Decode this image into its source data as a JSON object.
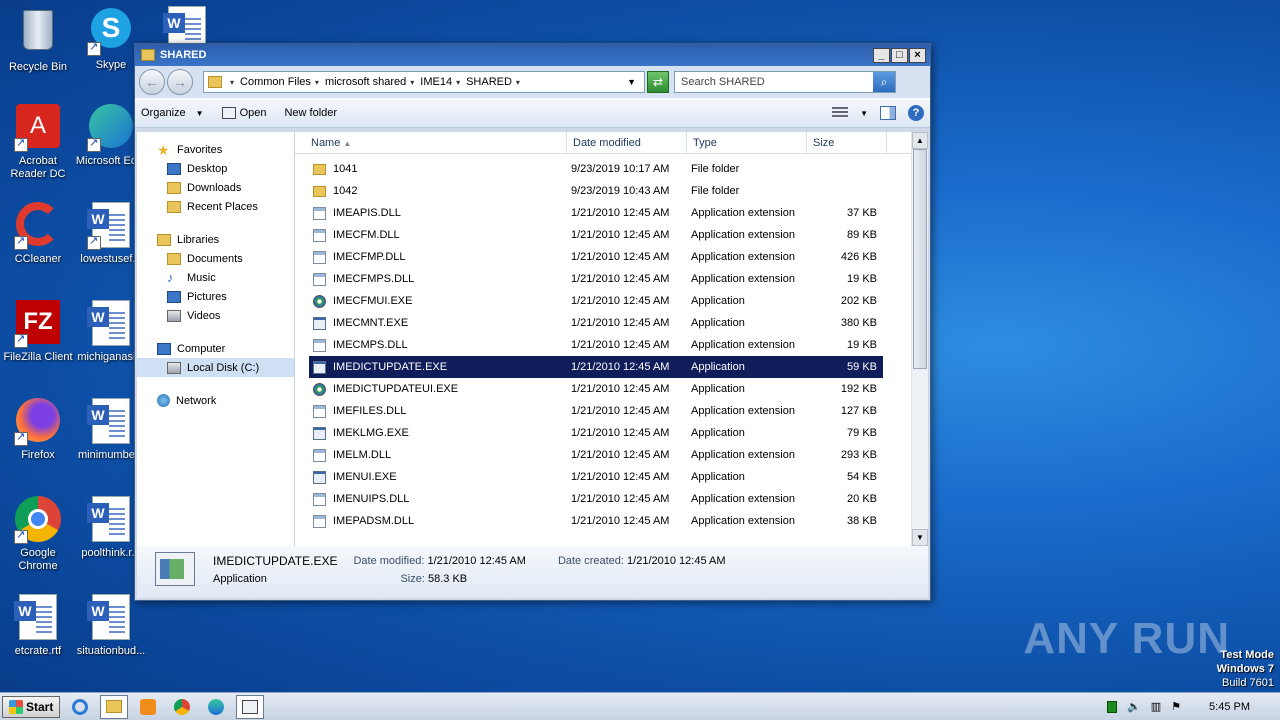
{
  "desktop": {
    "icons": [
      {
        "label": "Recycle Bin"
      },
      {
        "label": "Skype"
      },
      {
        "label": "Acrobat Reader DC"
      },
      {
        "label": "Microsoft Ed..."
      },
      {
        "label": "CCleaner"
      },
      {
        "label": "lowestusef..."
      },
      {
        "label": "FileZilla Client"
      },
      {
        "label": "michiganasi..."
      },
      {
        "label": "Firefox"
      },
      {
        "label": "minimumbe..."
      },
      {
        "label": "Google Chrome"
      },
      {
        "label": "poolthink.r..."
      },
      {
        "label": "etcrate.rtf"
      },
      {
        "label": "situationbud..."
      }
    ],
    "watermark": "ANY RUN",
    "test_mode": {
      "line1": "Test Mode",
      "line2": "Windows 7",
      "line3": "Build 7601"
    }
  },
  "window": {
    "title": "SHARED",
    "controls": {
      "minimize": "_",
      "maximize": "□",
      "close": "×"
    },
    "address": {
      "crumbs": [
        "Common Files",
        "microsoft shared",
        "IME14",
        "SHARED"
      ]
    },
    "search": {
      "placeholder": "Search SHARED"
    },
    "toolbar": {
      "organize": "Organize",
      "open": "Open",
      "new_folder": "New folder"
    },
    "nav": {
      "favorites": "Favorites",
      "desktop": "Desktop",
      "downloads": "Downloads",
      "recent": "Recent Places",
      "libraries": "Libraries",
      "documents": "Documents",
      "music": "Music",
      "pictures": "Pictures",
      "videos": "Videos",
      "computer": "Computer",
      "local_disk": "Local Disk (C:)",
      "network": "Network"
    },
    "columns": {
      "name": "Name",
      "date": "Date modified",
      "type": "Type",
      "size": "Size"
    },
    "files": [
      {
        "name": "1041",
        "date": "9/23/2019 10:17 AM",
        "type": "File folder",
        "size": "",
        "icon": "folder"
      },
      {
        "name": "1042",
        "date": "9/23/2019 10:43 AM",
        "type": "File folder",
        "size": "",
        "icon": "folder"
      },
      {
        "name": "IMEAPIS.DLL",
        "date": "1/21/2010 12:45 AM",
        "type": "Application extension",
        "size": "37 KB",
        "icon": "dll"
      },
      {
        "name": "IMECFM.DLL",
        "date": "1/21/2010 12:45 AM",
        "type": "Application extension",
        "size": "89 KB",
        "icon": "dll"
      },
      {
        "name": "IMECFMP.DLL",
        "date": "1/21/2010 12:45 AM",
        "type": "Application extension",
        "size": "426 KB",
        "icon": "dll"
      },
      {
        "name": "IMECFMPS.DLL",
        "date": "1/21/2010 12:45 AM",
        "type": "Application extension",
        "size": "19 KB",
        "icon": "dll"
      },
      {
        "name": "IMECFMUI.EXE",
        "date": "1/21/2010 12:45 AM",
        "type": "Application",
        "size": "202 KB",
        "icon": "exe-green"
      },
      {
        "name": "IMECMNT.EXE",
        "date": "1/21/2010 12:45 AM",
        "type": "Application",
        "size": "380 KB",
        "icon": "exe"
      },
      {
        "name": "IMECMPS.DLL",
        "date": "1/21/2010 12:45 AM",
        "type": "Application extension",
        "size": "19 KB",
        "icon": "dll"
      },
      {
        "name": "IMEDICTUPDATE.EXE",
        "date": "1/21/2010 12:45 AM",
        "type": "Application",
        "size": "59 KB",
        "icon": "exe"
      },
      {
        "name": "IMEDICTUPDATEUI.EXE",
        "date": "1/21/2010 12:45 AM",
        "type": "Application",
        "size": "192 KB",
        "icon": "exe-green"
      },
      {
        "name": "IMEFILES.DLL",
        "date": "1/21/2010 12:45 AM",
        "type": "Application extension",
        "size": "127 KB",
        "icon": "dll"
      },
      {
        "name": "IMEKLMG.EXE",
        "date": "1/21/2010 12:45 AM",
        "type": "Application",
        "size": "79 KB",
        "icon": "exe"
      },
      {
        "name": "IMELM.DLL",
        "date": "1/21/2010 12:45 AM",
        "type": "Application extension",
        "size": "293 KB",
        "icon": "dll"
      },
      {
        "name": "IMENUI.EXE",
        "date": "1/21/2010 12:45 AM",
        "type": "Application",
        "size": "54 KB",
        "icon": "exe"
      },
      {
        "name": "IMENUIPS.DLL",
        "date": "1/21/2010 12:45 AM",
        "type": "Application extension",
        "size": "20 KB",
        "icon": "dll"
      },
      {
        "name": "IMEPADSM.DLL",
        "date": "1/21/2010 12:45 AM",
        "type": "Application extension",
        "size": "38 KB",
        "icon": "dll"
      }
    ],
    "selected_index": 9,
    "details": {
      "name": "IMEDICTUPDATE.EXE",
      "type": "Application",
      "modified_label": "Date modified:",
      "modified": "1/21/2010 12:45 AM",
      "size_label": "Size:",
      "size": "58.3 KB",
      "created_label": "Date created:",
      "created": "1/21/2010 12:45 AM"
    }
  },
  "taskbar": {
    "start": "Start",
    "clock": "5:45 PM"
  }
}
